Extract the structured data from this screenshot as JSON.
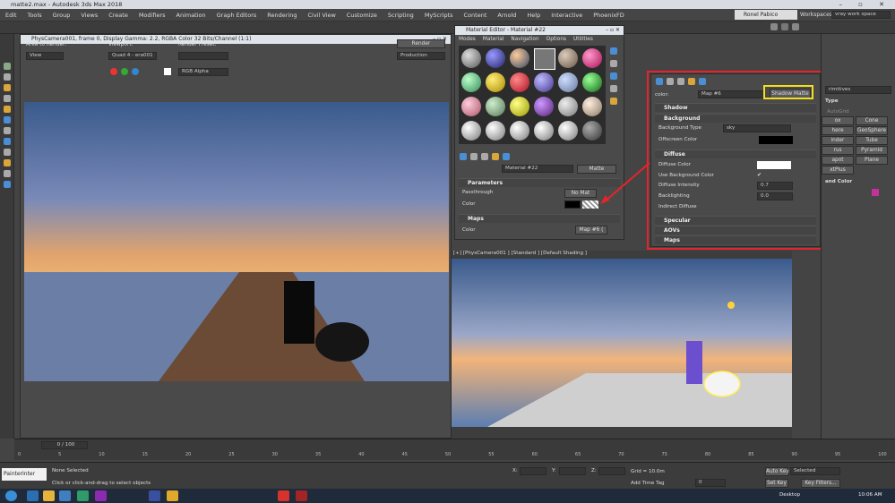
{
  "app_title": "matte2.max - Autodesk 3ds Max 2018",
  "menu": [
    "Edit",
    "Tools",
    "Group",
    "Views",
    "Create",
    "Modifiers",
    "Animation",
    "Graph Editors",
    "Rendering",
    "Civil View",
    "Customize",
    "Scripting",
    "MyScripts",
    "Content",
    "Arnold",
    "Help",
    "Interactive",
    "PhoenixFD"
  ],
  "user": "Ronel Pabico",
  "workspaces_label": "Workspaces:",
  "workspace": "vray work space",
  "frame_window": {
    "title": "PhysCamera001, frame 0, Display Gamma: 2.2, RGBA Color 32 Bits/Channel (1:1)",
    "area_label": "Area to Render:",
    "area_value": "View",
    "viewport_label": "Viewport:",
    "viewport_value": "Quad 4 - era001",
    "preset_label": "Render Preset:",
    "preset_value": "",
    "render_btn": "Render",
    "production": "Production",
    "channel": "RGB Alpha"
  },
  "mat_editor": {
    "title": "Material Editor - Material #22",
    "menus": [
      "Modes",
      "Material",
      "Navigation",
      "Options",
      "Utilities"
    ],
    "material_name": "Material #22",
    "material_type": "Matte",
    "params_header": "Parameters",
    "passthrough_label": "Passthrough",
    "passthrough_value": "No Mat",
    "color_label": "Color",
    "maps_header": "Maps",
    "maps_color_label": "Color",
    "maps_color_value": "Map #6  ("
  },
  "shadow_matte": {
    "color_label": "color:",
    "map_name": "Map #6",
    "type_btn": "Shadow Matte",
    "sections": {
      "shadow": "Shadow",
      "background": "Background",
      "diffuse": "Diffuse",
      "specular": "Specular",
      "aovs": "AOVs",
      "maps": "Maps"
    },
    "bg_type_label": "Background Type",
    "bg_type_value": "sky",
    "offscreen_label": "Offscreen Color",
    "diffuse_color_label": "Diffuse Color",
    "use_bg_label": "Use Background Color",
    "diffuse_intensity_label": "Diffuse Intensity",
    "diffuse_intensity_value": "0.7",
    "backlighting_label": "Backlighting",
    "backlighting_value": "0.0",
    "indirect_label": "Indirect Diffuse"
  },
  "command_panel": {
    "dropdown": "rimitives",
    "section": "Type",
    "autogrid": "AutoGrid",
    "buttons": [
      "ox",
      "Cone",
      "here",
      "GeoSphere",
      "inder",
      "Tube",
      "rus",
      "Pyramid",
      "apot",
      "Plane",
      "xtPlus"
    ],
    "name_color": "and Color"
  },
  "viewport_label": "[+] [PhysCamera001 ] [Standard ] [Default Shading ]",
  "timeline": {
    "frame": "0 / 100",
    "ticks": [
      "0",
      "5",
      "10",
      "15",
      "20",
      "25",
      "30",
      "35",
      "40",
      "45",
      "50",
      "55",
      "60",
      "65",
      "70",
      "75",
      "80",
      "85",
      "90",
      "95",
      "100"
    ]
  },
  "status": {
    "painter": "PainterInter",
    "selected": "None Selected",
    "hint": "Click or click-and-drag to select objects",
    "x_label": "X:",
    "y_label": "Y:",
    "z_label": "Z:",
    "grid": "Grid = 10.0m",
    "add_time_tag": "Add Time Tag",
    "auto_key": "Auto Key",
    "set_key": "Set Key",
    "selected_dd": "Selected",
    "key_filters": "Key Filters...",
    "frame_field": "0"
  },
  "taskbar": {
    "desktop": "Desktop",
    "time": "10:06 AM"
  }
}
